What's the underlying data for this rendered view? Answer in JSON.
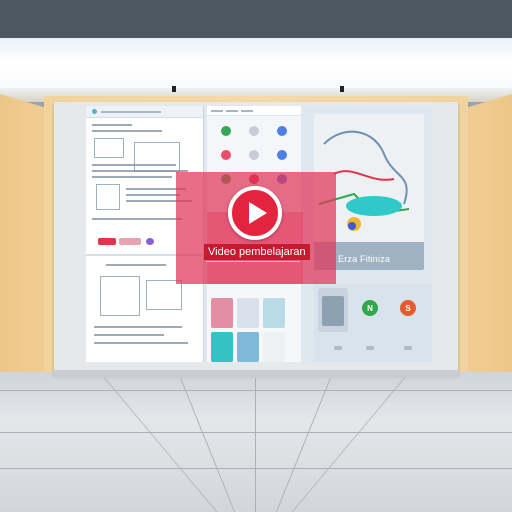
{
  "video": {
    "label": "Video pembelajaran",
    "play_icon": "play-icon",
    "accent_color": "#e4243e"
  },
  "screen": {
    "map_caption": "Erza Fitiniza",
    "apps": [
      {
        "letter": "",
        "color": "#34a853"
      },
      {
        "letter": "",
        "color": "#4f7fe6"
      },
      {
        "letter": "",
        "color": "#e94f6b"
      },
      {
        "letter": "",
        "color": "#4f7fe6"
      },
      {
        "letter": "",
        "color": "#2fb44a"
      },
      {
        "letter": "",
        "color": "#e2334c"
      },
      {
        "letter": "",
        "color": "#4f7fe6"
      },
      {
        "letter": "",
        "color": "#e2334c"
      }
    ],
    "participants": [
      {
        "letter": "N",
        "color": "#2fa84a"
      },
      {
        "letter": "S",
        "color": "#e55b2d"
      }
    ]
  },
  "colors": {
    "wall": "#f2d29c",
    "floor": "#dde1e5",
    "display": "#e6e9ec"
  }
}
